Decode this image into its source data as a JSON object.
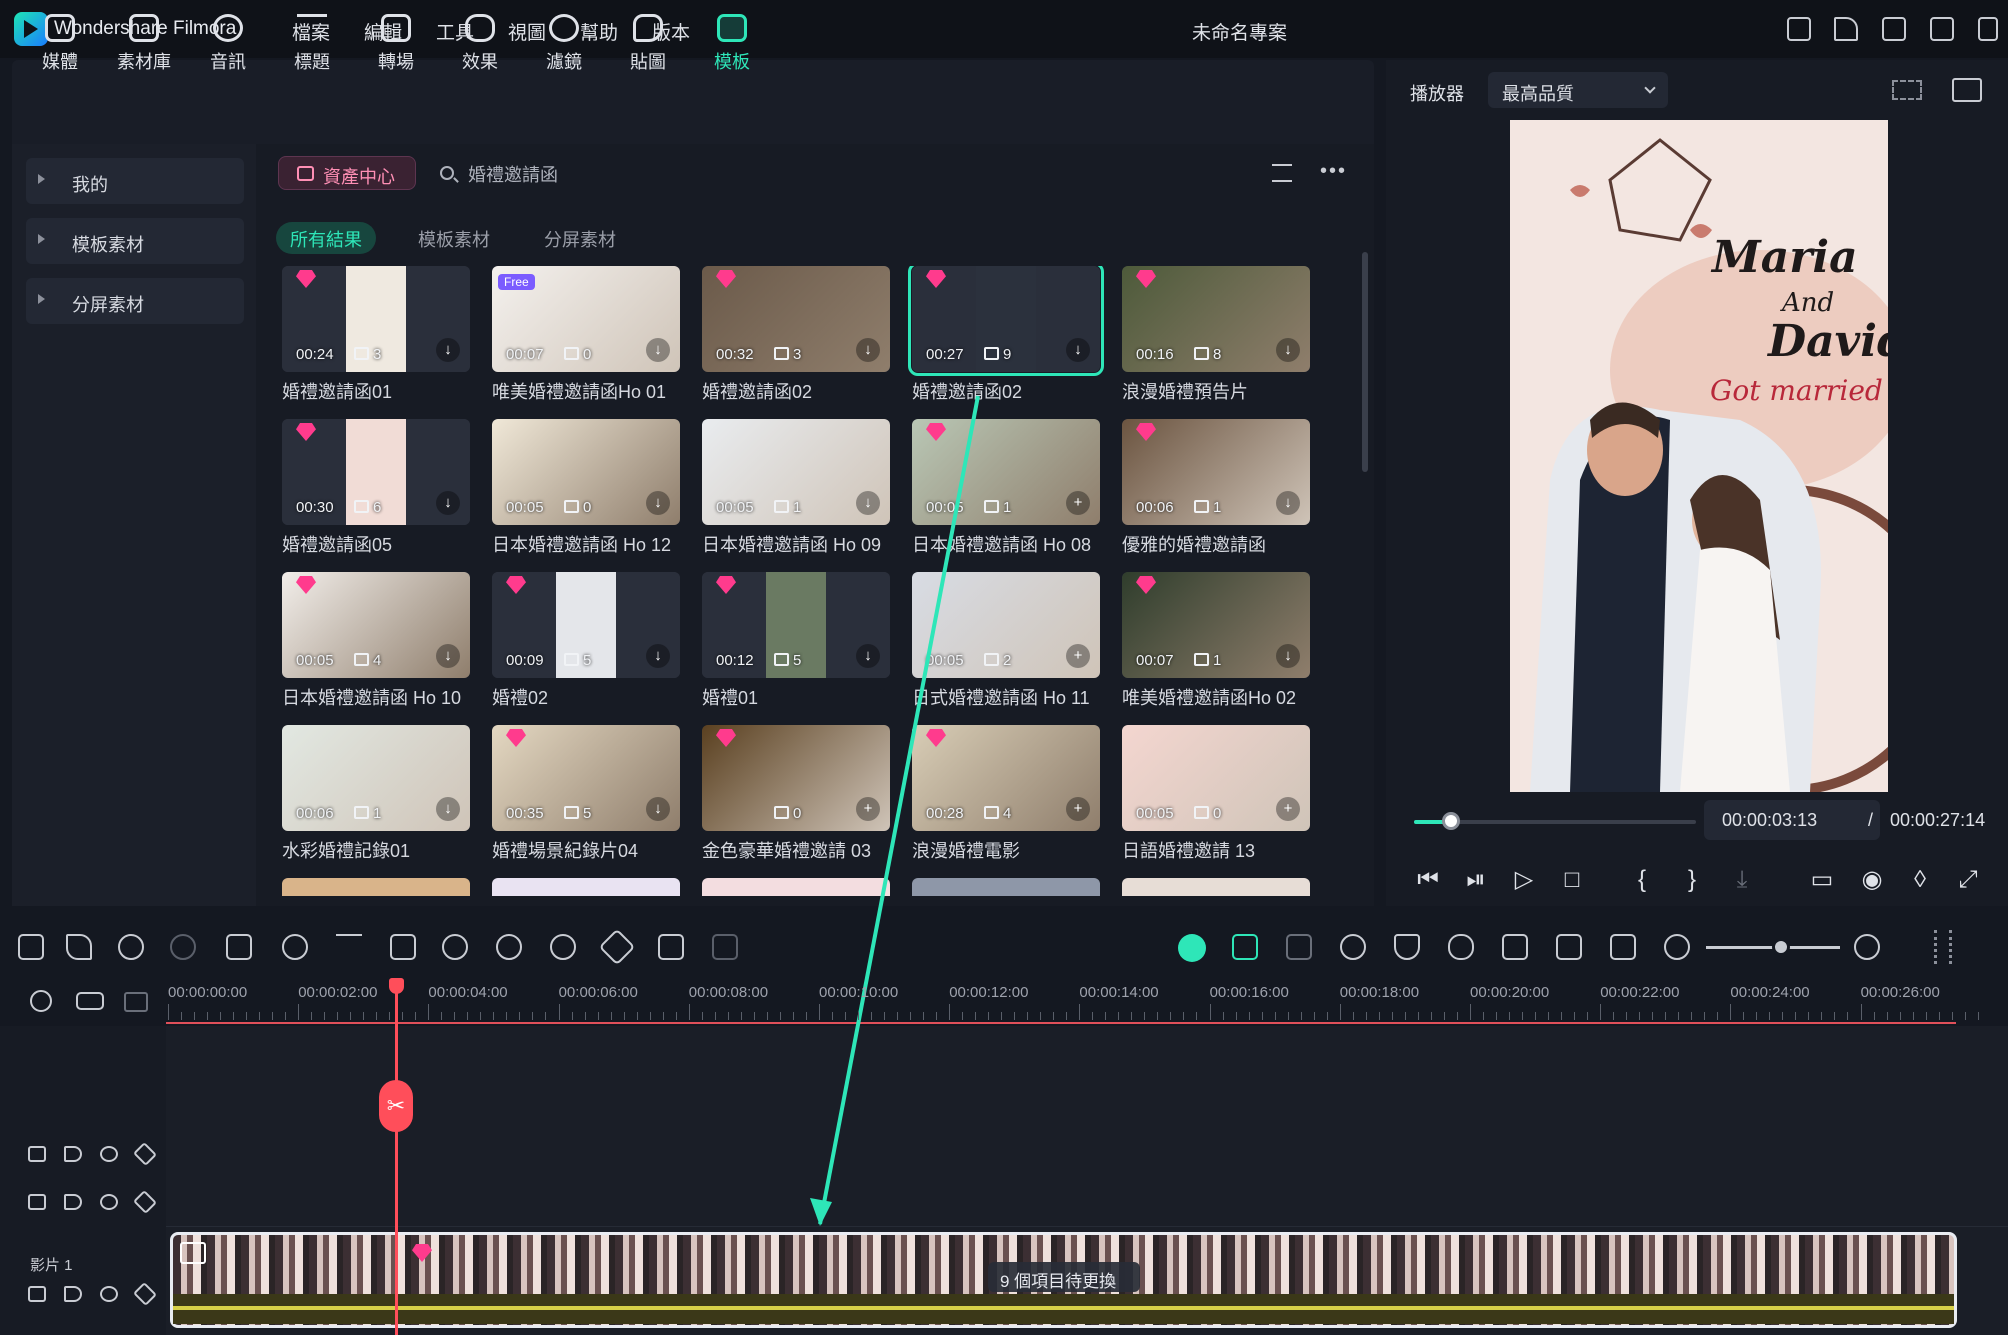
{
  "app": {
    "name": "Wondershare Filmora",
    "project_title": "未命名專案"
  },
  "menu": [
    "檔案",
    "編輯",
    "工具",
    "視圖",
    "幫助",
    "版本"
  ],
  "tools": [
    {
      "label": "媒體",
      "icon": "media-icon"
    },
    {
      "label": "素材庫",
      "icon": "stock-icon"
    },
    {
      "label": "音訊",
      "icon": "music-icon"
    },
    {
      "label": "標題",
      "icon": "title-icon"
    },
    {
      "label": "轉場",
      "icon": "transition-icon"
    },
    {
      "label": "效果",
      "icon": "effects-icon"
    },
    {
      "label": "濾鏡",
      "icon": "filter-icon"
    },
    {
      "label": "貼圖",
      "icon": "sticker-icon"
    },
    {
      "label": "模板",
      "icon": "template-icon",
      "active": true
    }
  ],
  "sidebar": {
    "items": [
      {
        "label": "我的"
      },
      {
        "label": "模板素材"
      },
      {
        "label": "分屏素材"
      }
    ]
  },
  "library": {
    "asset_center": "資產中心",
    "search": {
      "value": "婚禮邀請函"
    },
    "filters": [
      "所有結果",
      "模板素材",
      "分屏素材"
    ],
    "cards": [
      {
        "name": "婚禮邀請函01",
        "dur": "00:24",
        "count": "3",
        "gem": true
      },
      {
        "name": "唯美婚禮邀請函Ho 01",
        "dur": "00:07",
        "count": "0",
        "free": "Free"
      },
      {
        "name": "婚禮邀請函02",
        "dur": "00:32",
        "count": "3",
        "gem": true
      },
      {
        "name": "婚禮邀請函02",
        "dur": "00:27",
        "count": "9",
        "gem": true,
        "selected": true
      },
      {
        "name": "浪漫婚禮預告片",
        "dur": "00:16",
        "count": "8",
        "gem": true
      },
      {
        "name": "婚禮邀請函05",
        "dur": "00:30",
        "count": "6",
        "gem": true
      },
      {
        "name": "日本婚禮邀請函 Ho 12",
        "dur": "00:05",
        "count": "0"
      },
      {
        "name": "日本婚禮邀請函 Ho 09",
        "dur": "00:05",
        "count": "1"
      },
      {
        "name": "日本婚禮邀請函 Ho 08",
        "dur": "00:05",
        "count": "1",
        "gem": true
      },
      {
        "name": "優雅的婚禮邀請函",
        "dur": "00:06",
        "count": "1",
        "gem": true
      },
      {
        "name": "日本婚禮邀請函 Ho 10",
        "dur": "00:05",
        "count": "4",
        "gem": true
      },
      {
        "name": "婚禮02",
        "dur": "00:09",
        "count": "5",
        "gem": true
      },
      {
        "name": "婚禮01",
        "dur": "00:12",
        "count": "5",
        "gem": true
      },
      {
        "name": "日式婚禮邀請函 Ho 11",
        "dur": "00:05",
        "count": "2"
      },
      {
        "name": "唯美婚禮邀請函Ho 02",
        "dur": "00:07",
        "count": "1",
        "gem": true
      },
      {
        "name": "水彩婚禮記錄01",
        "dur": "00:06",
        "count": "1"
      },
      {
        "name": "婚禮場景紀錄片04",
        "dur": "00:35",
        "count": "5",
        "gem": true
      },
      {
        "name": "金色豪華婚禮邀請 03",
        "dur": "",
        "count": "0",
        "gem": true
      },
      {
        "name": "浪漫婚禮電影",
        "dur": "00:28",
        "count": "4",
        "gem": true
      },
      {
        "name": "日語婚禮邀請 13",
        "dur": "00:05",
        "count": "0"
      }
    ]
  },
  "player": {
    "label": "播放器",
    "quality": "最高品質",
    "current_time": "00:00:03:13",
    "separator": "/",
    "total_time": "00:00:27:14",
    "progress": 0.13,
    "preview_text": {
      "name1": "Maria",
      "and": "And",
      "name2": "David",
      "sub": "Got married"
    }
  },
  "timeline": {
    "ticks": [
      "00:00:00:00",
      "00:00:02:00",
      "00:00:04:00",
      "00:00:06:00",
      "00:00:08:00",
      "00:00:10:00",
      "00:00:12:00",
      "00:00:14:00",
      "00:00:16:00",
      "00:00:18:00",
      "00:00:20:00",
      "00:00:22:00",
      "00:00:24:00",
      "00:00:26:00"
    ],
    "track_name": "影片 1",
    "pending": "9 個項目待更換",
    "playhead_time_fraction": 0.13
  },
  "colors": {
    "accent": "#2ee6b8",
    "playhead": "#ff4e5a",
    "gem": "#ff3b8d"
  }
}
